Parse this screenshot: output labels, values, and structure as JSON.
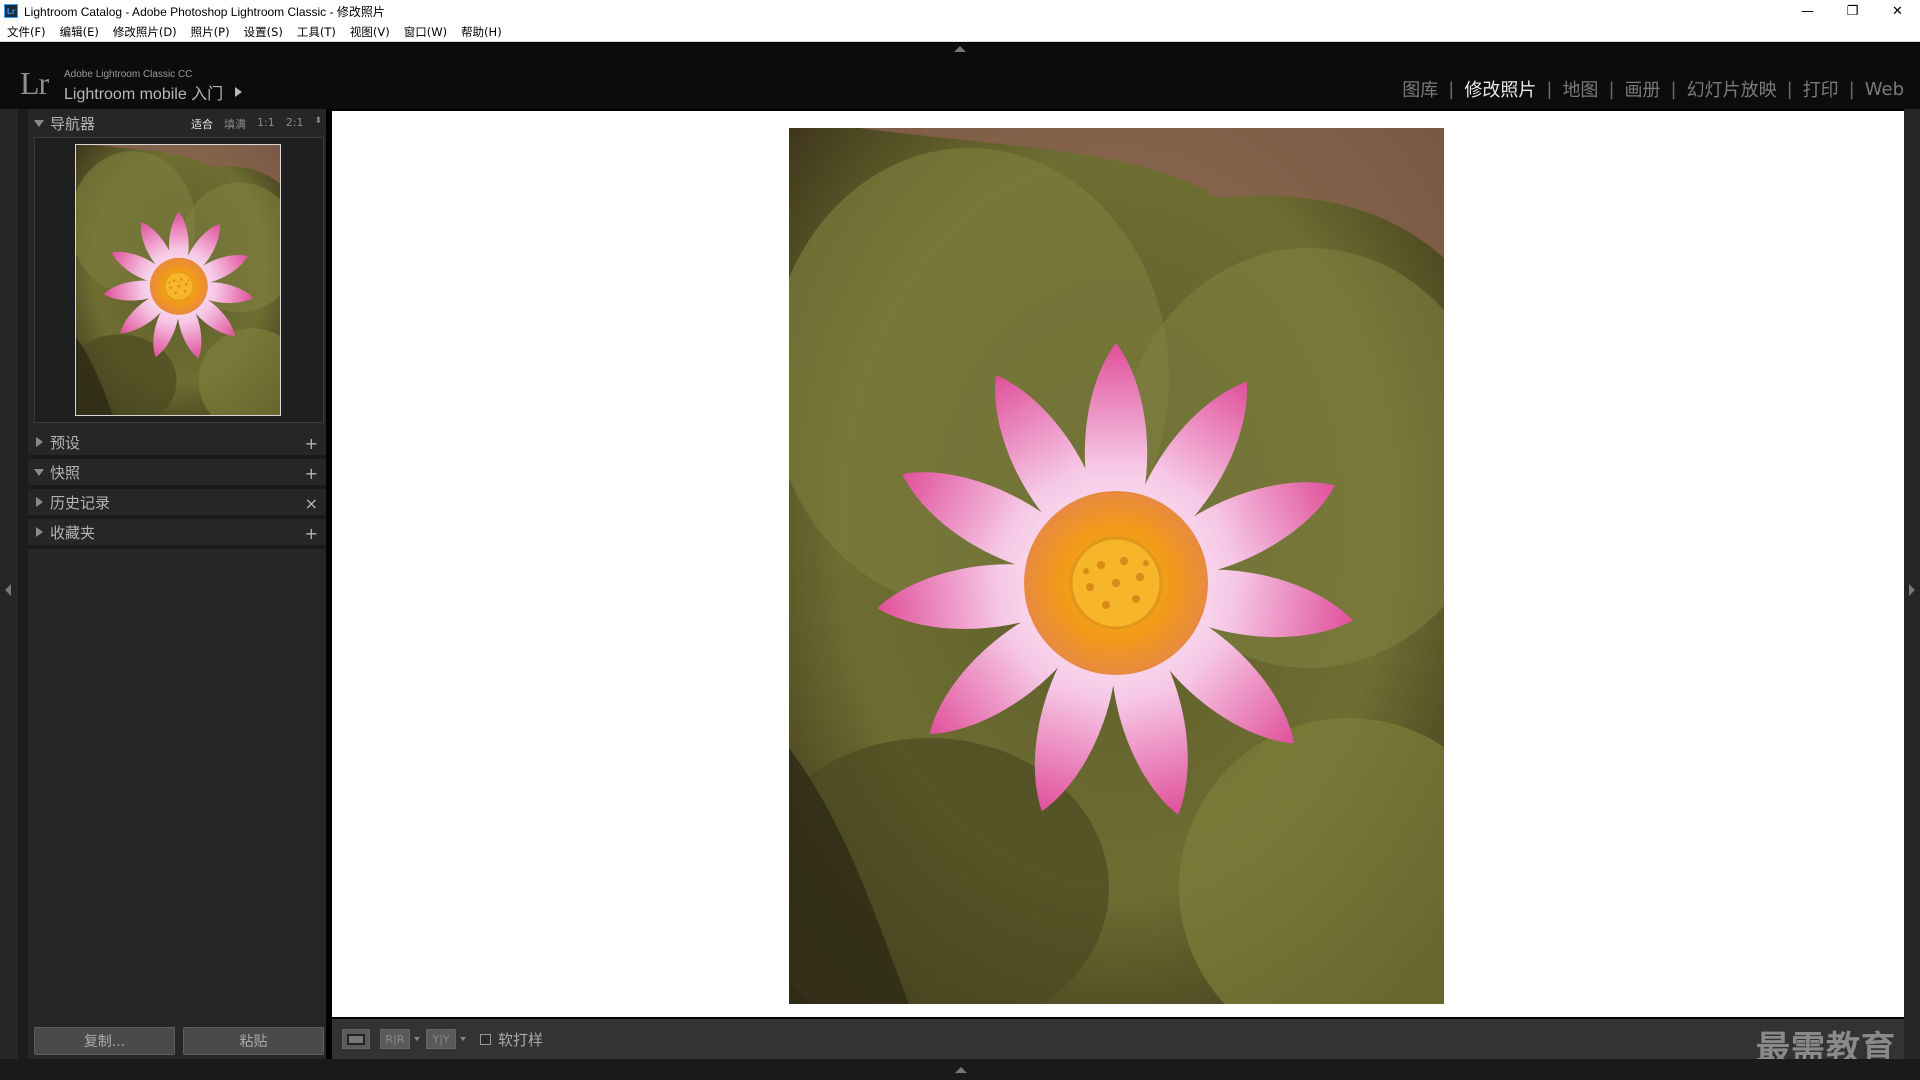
{
  "window": {
    "title": "Lightroom Catalog - Adobe Photoshop Lightroom Classic - 修改照片",
    "app_badge": "Lr",
    "minimize": "—",
    "restore": "❐",
    "close": "✕"
  },
  "menubar": {
    "items": [
      "文件(F)",
      "编辑(E)",
      "修改照片(D)",
      "照片(P)",
      "设置(S)",
      "工具(T)",
      "视图(V)",
      "窗口(W)",
      "帮助(H)"
    ]
  },
  "identity": {
    "logo": "Lr",
    "product": "Adobe Lightroom Classic CC",
    "mobile_label": "Lightroom mobile 入门"
  },
  "modules": {
    "items": [
      "图库",
      "修改照片",
      "地图",
      "画册",
      "幻灯片放映",
      "打印",
      "Web"
    ],
    "active": "修改照片",
    "separator": "|"
  },
  "navigator": {
    "title": "导航器",
    "zoom_options": [
      "适合",
      "填满",
      "1:1",
      "2:1"
    ],
    "active_zoom": "适合",
    "zoom_updown": "⬍"
  },
  "left_panels": [
    {
      "title": "预设",
      "expanded": false,
      "action": "+"
    },
    {
      "title": "快照",
      "expanded": true,
      "action": "+"
    },
    {
      "title": "历史记录",
      "expanded": false,
      "action": "×"
    },
    {
      "title": "收藏夹",
      "expanded": false,
      "action": "+"
    }
  ],
  "left_buttons": {
    "copy": "复制...",
    "paste": "粘贴"
  },
  "toolbar": {
    "view_single_icon": "loupe-view-icon",
    "before_after_label": "R|R",
    "before_after_y_label": "Y|Y",
    "soft_proof_label": "软打样",
    "soft_proof_checked": false
  },
  "watermark": "最需教育",
  "colors": {
    "accent_blue": "#31a8ff",
    "panel_bg": "#262626",
    "active_text": "#e8e8e8"
  }
}
